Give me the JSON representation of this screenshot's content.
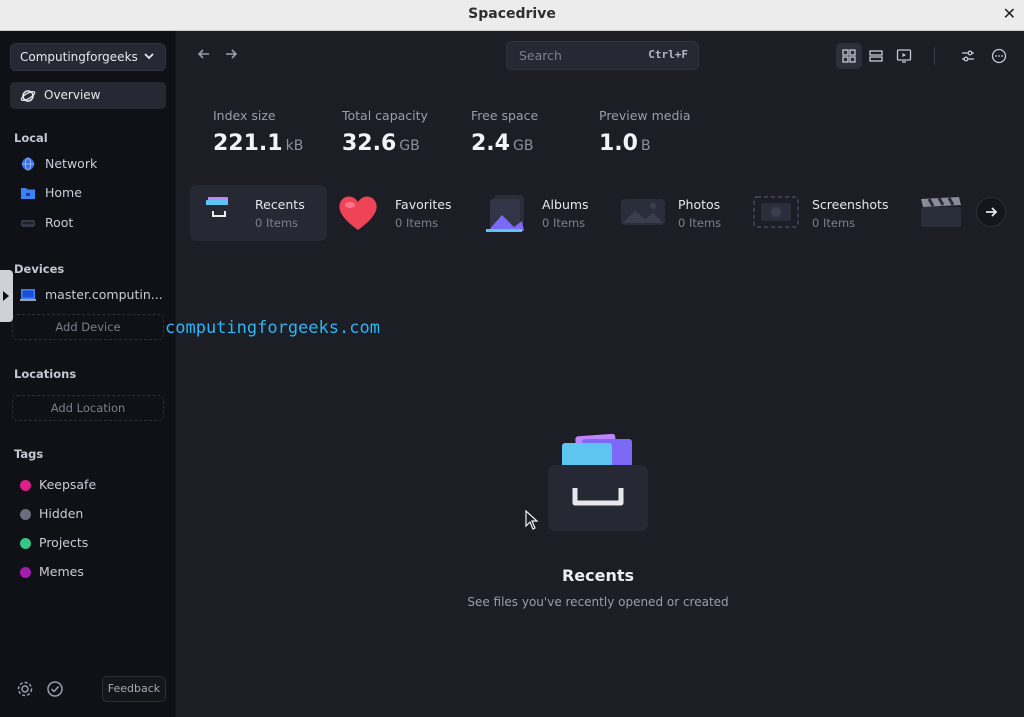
{
  "window": {
    "title": "Spacedrive"
  },
  "sidebar": {
    "library": "Computingforgeeks",
    "overview": "Overview",
    "local_label": "Local",
    "local_items": [
      {
        "label": "Network",
        "icon": "network-icon"
      },
      {
        "label": "Home",
        "icon": "home-folder-icon"
      },
      {
        "label": "Root",
        "icon": "drive-icon"
      }
    ],
    "devices_label": "Devices",
    "device": "master.computin...",
    "add_device": "Add Device",
    "locations_label": "Locations",
    "add_location": "Add Location",
    "tags_label": "Tags",
    "tags": [
      {
        "label": "Keepsafe",
        "color": "#e11d8a"
      },
      {
        "label": "Hidden",
        "color": "#6b6e7a"
      },
      {
        "label": "Projects",
        "color": "#34c785"
      },
      {
        "label": "Memes",
        "color": "#a21caf"
      }
    ],
    "feedback": "Feedback"
  },
  "toolbar": {
    "search_placeholder": "Search",
    "search_shortcut": "Ctrl+F"
  },
  "stats": [
    {
      "label": "Index size",
      "value": "221.1",
      "unit": "kB"
    },
    {
      "label": "Total capacity",
      "value": "32.6",
      "unit": "GB"
    },
    {
      "label": "Free space",
      "value": "2.4",
      "unit": "GB"
    },
    {
      "label": "Preview media",
      "value": "1.0",
      "unit": "B"
    }
  ],
  "categories": [
    {
      "label": "Recents",
      "count": "0 Items"
    },
    {
      "label": "Favorites",
      "count": "0 Items"
    },
    {
      "label": "Albums",
      "count": "0 Items"
    },
    {
      "label": "Photos",
      "count": "0 Items"
    },
    {
      "label": "Screenshots",
      "count": "0 Items"
    }
  ],
  "watermark": "computingforgeeks.com",
  "empty_state": {
    "title": "Recents",
    "subtitle": "See files you've recently opened or created"
  },
  "colors": {
    "accent": "#2563eb",
    "background": "#1c1d25",
    "sidebar": "#101116"
  }
}
